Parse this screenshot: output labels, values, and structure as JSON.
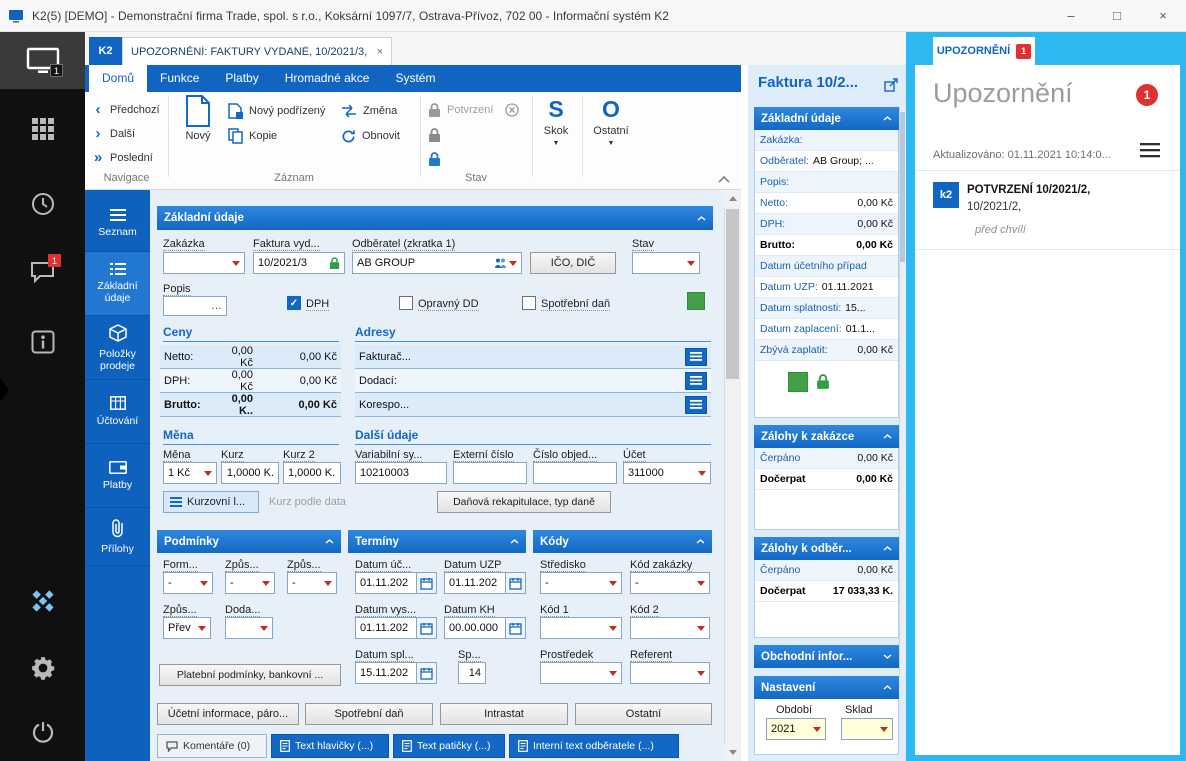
{
  "colors": {
    "accent_blue": "#1165c0",
    "section_header_blue": "#1268c4",
    "cyan": "#2eb8f2",
    "badge_red": "#e03131",
    "confirm_green": "#43a047"
  },
  "glyphs": {
    "prev": "‹",
    "next": "›",
    "last": "»",
    "caret": "▼",
    "ellipsis": "…",
    "check": "✓",
    "close": "×",
    "minimize": "–",
    "maximize": "□"
  },
  "window": {
    "title": "K2(5) [DEMO] - Demonstrační firma Trade, spol. s r.o., Koksární 1097/7, Ostrava-Přívoz, 702 00 - Informační systém K2"
  },
  "sidebar": {
    "monitor_badge": "1",
    "chat_badge": "1"
  },
  "tabs": {
    "k2": "K2",
    "document": "UPOZORNĚNÍ: FAKTURY VYDANÉ, 10/2021/3,"
  },
  "ribbon": {
    "menus": [
      {
        "label": "Domů"
      },
      {
        "label": "Funkce"
      },
      {
        "label": "Platby"
      },
      {
        "label": "Hromadné akce"
      },
      {
        "label": "Systém"
      }
    ],
    "navigace": {
      "prev": "Předchozí",
      "next": "Další",
      "last": "Poslední",
      "label": "Navigace"
    },
    "zaznam": {
      "new": "Nový",
      "new_child": "Nový podřízený",
      "copy": "Kopie",
      "change": "Změna",
      "refresh": "Obnovit",
      "label": "Záznam"
    },
    "stav": {
      "confirm": "Potvrzení",
      "label": "Stav"
    },
    "skok": "Skok",
    "skok_icon": "S",
    "ostatni": "Ostatní",
    "ostatni_icon": "O"
  },
  "nav_tabs": [
    {
      "label": "Seznam"
    },
    {
      "label": "Základní údaje"
    },
    {
      "label": "Položky prodeje"
    },
    {
      "label": "Účtování"
    },
    {
      "label": "Platby"
    },
    {
      "label": "Přílohy"
    }
  ],
  "form": {
    "section_title": "Základní údaje",
    "fields": {
      "zakazka_label": "Zakázka",
      "faktura_label": "Faktura vyd...",
      "faktura_value": "10/2021/3",
      "odberatel_label": "Odběratel (zkratka 1)",
      "odberatel_value": "AB GROUP",
      "ico_dic_button": "IČO, DIČ",
      "stav_label": "Stav",
      "popis_label": "Popis",
      "dph_label": "DPH",
      "opravny_label": "Opravný DD",
      "spotrebni_label": "Spotřební daň"
    },
    "ceny": {
      "title": "Ceny",
      "rows": [
        {
          "label": "Netto:",
          "v1": "0,00 Kč",
          "v2": "0,00 Kč"
        },
        {
          "label": "DPH:",
          "v1": "0,00 Kč",
          "v2": "0,00 Kč"
        },
        {
          "label": "Brutto:",
          "v1": "0,00 K..",
          "v2": "0,00 Kč"
        }
      ]
    },
    "adresy": {
      "title": "Adresy",
      "rows": [
        {
          "label": "Fakturač..."
        },
        {
          "label": "Dodací:"
        },
        {
          "label": "Korespo..."
        }
      ]
    },
    "mena": {
      "title": "Měna",
      "mena_label": "Měna",
      "mena_value": "1 Kč",
      "kurz_label": "Kurz",
      "kurz_value": "1,0000 K.",
      "kurz2_label": "Kurz 2",
      "kurz2_value": "1,0000 K.."
    },
    "dalsi": {
      "title": "Další údaje",
      "vs_label": "Variabilní sy...",
      "vs_value": "10210003",
      "ext_label": "Externí číslo",
      "ext_value": "",
      "obj_label": "Číslo objed...",
      "obj_value": "",
      "ucet_label": "Účet",
      "ucet_value": "311000"
    },
    "buttons": {
      "kurzovni": "Kurzovní l...",
      "kurz_podle_data": "Kurz podle data",
      "danova": "Daňová rekapitulace, typ daně",
      "platebni": "Platební podmínky, bankovní ...",
      "ucetni": "Účetní informace, páro...",
      "spotrebni": "Spotřební daň",
      "intrastat": "Intrastat",
      "ostatni": "Ostatní"
    },
    "podminky": {
      "title": "Podmínky",
      "f1_label": "Form...",
      "f1_value": "-",
      "f2_label": "Způs...",
      "f2_value": "-",
      "f3_label": "Způs...",
      "f3_value": "-",
      "f4_label": "Způs...",
      "f4_value": "Přev",
      "f5_label": "Doda...",
      "f5_value": ""
    },
    "terminy": {
      "title": "Termíny",
      "d1_label": "Datum úč...",
      "d1_value": "01.11.202",
      "d2_label": "Datum UZP",
      "d2_value": "01.11.202",
      "d3_label": "Datum vys...",
      "d3_value": "01.11.202",
      "d4_label": "Datum KH",
      "d4_value": "00.00.000",
      "d5_label": "Datum spl...",
      "d5_value": "15.11.202",
      "d6_label": "Sp...",
      "d6_value": "14"
    },
    "kody": {
      "title": "Kódy",
      "k1_label": "Středisko",
      "k1_value": "-",
      "k2_label": "Kód zakázky",
      "k2_value": "-",
      "k3_label": "Kód 1",
      "k3_value": "",
      "k4_label": "Kód 2",
      "k4_value": "",
      "k5_label": "Prostředek",
      "k5_value": "",
      "k6_label": "Referent",
      "k6_value": ""
    },
    "bottom_tabs": [
      {
        "label": "Komentáře (0)"
      },
      {
        "label": "Text hlavičky (...)"
      },
      {
        "label": "Text patičky (...)"
      },
      {
        "label": "Interní text odběratele (...)"
      }
    ]
  },
  "preview": {
    "title": "Faktura 10/2...",
    "zakladni": {
      "title": "Základní údaje",
      "rows": [
        {
          "l": "Zakázka:",
          "v": ""
        },
        {
          "l": "Odběratel:",
          "v": "AB Group; ..."
        },
        {
          "l": "Popis:",
          "v": ""
        },
        {
          "l": "Netto:",
          "v": "0,00 Kč"
        },
        {
          "l": "DPH:",
          "v": "0,00 Kč"
        },
        {
          "l": "Brutto:",
          "v": "0,00 Kč"
        },
        {
          "l": "Datum účetního případ",
          "v": ""
        },
        {
          "l": "Datum UZP:",
          "v": "01.11.2021"
        },
        {
          "l": "Datum splatnosti:",
          "v": "15..."
        },
        {
          "l": "Datum zaplacení:",
          "v": "01.1..."
        },
        {
          "l": "Zbývá zaplatit:",
          "v": "0,00 Kč"
        }
      ]
    },
    "zalohy_zakazce": {
      "title": "Zálohy k zakázce",
      "rows": [
        {
          "l": "Čerpáno",
          "v": "0,00 Kč"
        },
        {
          "l": "Dočerpat",
          "v": "0,00 Kč"
        }
      ]
    },
    "zalohy_odberateli": {
      "title": "Zálohy k odběr...",
      "rows": [
        {
          "l": "Čerpáno",
          "v": "0,00 Kč"
        },
        {
          "l": "Dočerpat",
          "v": "17 033,33 K."
        }
      ]
    },
    "obchodni": {
      "title": "Obchodní infor..."
    },
    "nastaveni": {
      "title": "Nastavení",
      "obdobi_label": "Období",
      "obdobi_value": "2021",
      "sklad_label": "Sklad",
      "sklad_value": ""
    }
  },
  "notifications": {
    "tab_label": "UPOZORNĚNÍ",
    "tab_badge": "1",
    "title": "Upozornění",
    "badge": "1",
    "updated": "Aktualizováno: 01.11.2021 10:14:0...",
    "items": [
      {
        "icon": "k2",
        "title": "POTVRZENÍ 10/2021/2,",
        "subtitle": "10/2021/2,",
        "time": "před chvílí"
      }
    ]
  }
}
